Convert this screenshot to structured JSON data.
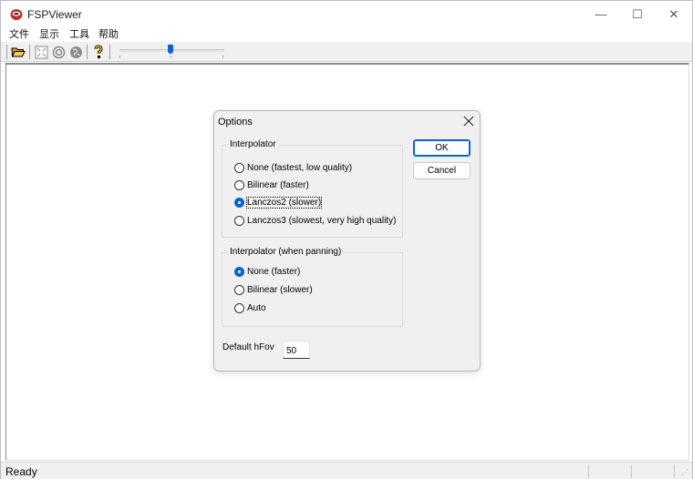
{
  "window": {
    "title": "FSPViewer",
    "minimize_glyph": "—",
    "maximize_glyph": "☐",
    "close_glyph": "✕"
  },
  "menu": [
    "文件",
    "显示",
    "工具",
    "帮助"
  ],
  "toolbar": {
    "icons": [
      "open-folder-icon",
      "fullscreen-icon",
      "target-icon",
      "globe-icon",
      "help-icon"
    ],
    "zoom_slider_value": 0.5
  },
  "status": {
    "text": "Ready"
  },
  "dialog": {
    "title": "Options",
    "close_glyph": "✕",
    "ok_label": "OK",
    "cancel_label": "Cancel",
    "interpolator": {
      "label": "Interpolator",
      "options": [
        "None (fastest, low quality)",
        "Bilinear (faster)",
        "Lanczos2 (slower)",
        "Lanczos3 (slowest, very high quality)"
      ],
      "selected": "Lanczos2 (slower)"
    },
    "interpolator_panning": {
      "label": "Interpolator (when panning)",
      "options": [
        "None (faster)",
        "Bilinear (slower)",
        "Auto"
      ],
      "selected": "None (faster)"
    },
    "hfov": {
      "label": "Default hFov",
      "value": "50"
    }
  },
  "colors": {
    "accent": "#0a64d2",
    "dialog_bg": "#f0f0f0"
  }
}
